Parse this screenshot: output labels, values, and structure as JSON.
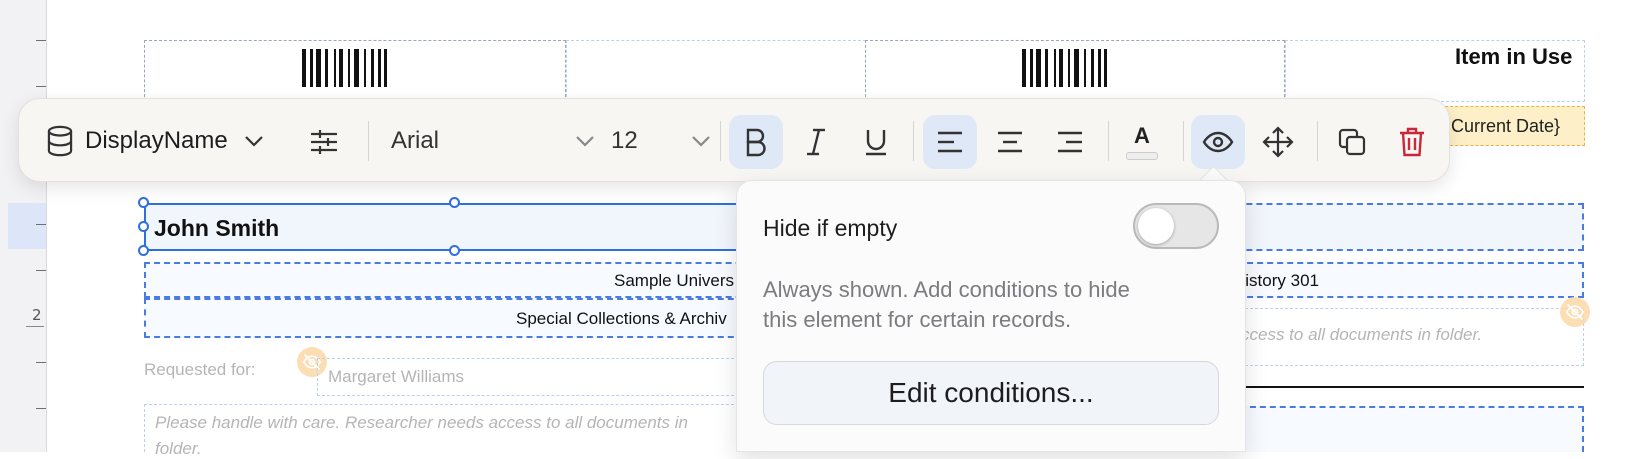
{
  "toolbar": {
    "field_name": "DisplayName",
    "font_family": "Arial",
    "font_size": "12",
    "font_color_glyph": "A"
  },
  "canvas": {
    "header_right": "Item in Use",
    "current_date_field": "Current Date}",
    "name": "John Smith",
    "university": "Sample Univers",
    "course": "History 301",
    "collections": "Special Collections & Archiv",
    "notes_right": "ccess to all documents in folder.",
    "requested_for_label": "Requested for:",
    "requested_for_value": "Margaret Williams",
    "handle_note": "Please handle with care. Researcher needs access to all documents in",
    "handle_note_cont": "folder."
  },
  "ruler": {
    "label": "2"
  },
  "popover": {
    "toggle_label": "Hide if empty",
    "toggle_on": false,
    "description_line1": "Always shown. Add conditions to hide",
    "description_line2": "this element for certain records.",
    "edit_button": "Edit conditions..."
  },
  "colors": {
    "accent": "#2f6fe0",
    "active_bg": "#dfe8f6",
    "delete": "#c8283a",
    "hidden_badge": "#fbd9a6"
  }
}
